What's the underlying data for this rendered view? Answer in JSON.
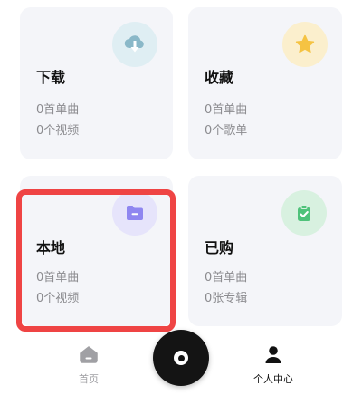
{
  "cards": {
    "download": {
      "title": "下载",
      "line1": "0首单曲",
      "line2": "0个视频",
      "icon": "cloud-download-icon",
      "icon_bg": "#dfeef3",
      "icon_color": "#8ab8c8"
    },
    "favorite": {
      "title": "收藏",
      "line1": "0首单曲",
      "line2": "0个歌单",
      "icon": "star-icon",
      "icon_bg": "#fbefcd",
      "icon_color": "#f5c342"
    },
    "local": {
      "title": "本地",
      "line1": "0首单曲",
      "line2": "0个视频",
      "icon": "folder-icon",
      "icon_bg": "#e6e4fb",
      "icon_color": "#8f86f0"
    },
    "purchased": {
      "title": "已购",
      "line1": "0首单曲",
      "line2": "0张专辑",
      "icon": "shopping-bag-check-icon",
      "icon_bg": "#d8f1e0",
      "icon_color": "#4fc27a"
    }
  },
  "highlight_color": "#ef4444",
  "tabbar": {
    "home_label": "首页",
    "me_label": "个人中心",
    "player_icon": "vinyl-disc-icon"
  }
}
